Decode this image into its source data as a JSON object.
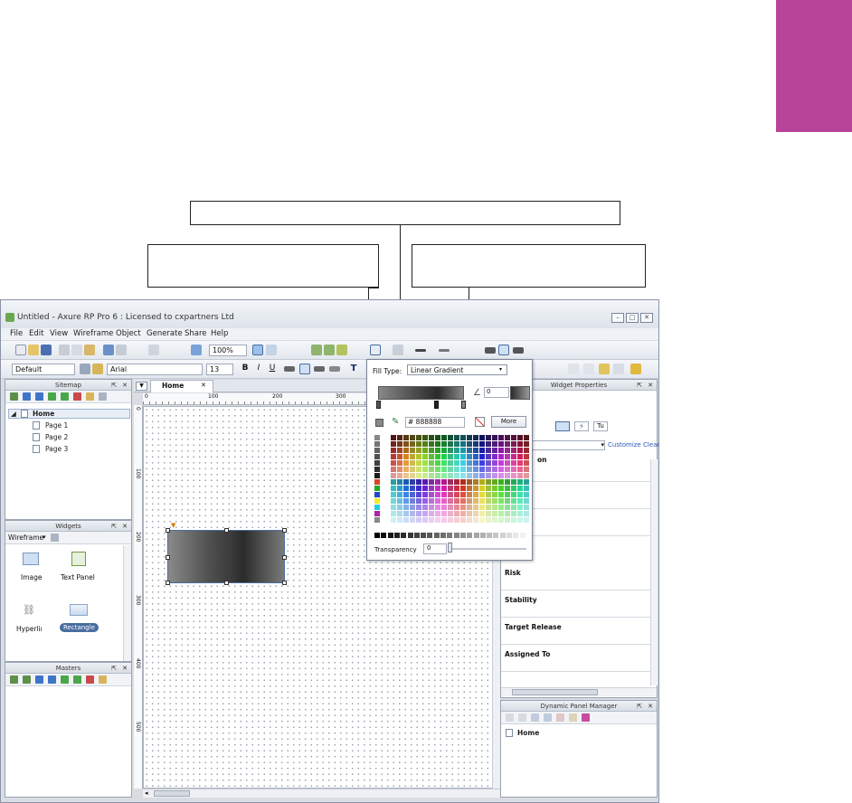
{
  "window": {
    "title": "Untitled - Axure RP Pro 6 : Licensed to cxpartners Ltd"
  },
  "menu": [
    "File",
    "Edit",
    "View",
    "Wireframe",
    "Object",
    "Generate",
    "Share",
    "Help"
  ],
  "toolbar": {
    "zoom": "100%",
    "style": "Default",
    "font": "Arial",
    "size": "13"
  },
  "sitemap": {
    "title": "Sitemap",
    "root": "Home",
    "pages": [
      "Page 1",
      "Page 2",
      "Page 3"
    ]
  },
  "widgets": {
    "title": "Widgets",
    "library": "Wireframe",
    "items": [
      "Image",
      "Text Panel",
      "Hyperlink",
      "Rectangle"
    ]
  },
  "masters": {
    "title": "Masters"
  },
  "canvas": {
    "tab": "Home",
    "ruler_top": [
      "0",
      "100",
      "200",
      "300"
    ],
    "ruler_left": [
      "0",
      "100",
      "200",
      "300",
      "400",
      "500"
    ]
  },
  "fill_popup": {
    "label": "Fill Type:",
    "type": "Linear Gradient",
    "angle": "0",
    "hex": "# 888888",
    "more": "More",
    "transparency_label": "Transparency",
    "transparency": "0"
  },
  "widget_properties": {
    "title": "Widget Properties",
    "customize": "Customize",
    "clear": "Clear",
    "partial": "on",
    "fields": [
      "Risk",
      "Stability",
      "Target Release",
      "Assigned To"
    ]
  },
  "dynamic_panel_manager": {
    "title": "Dynamic Panel Manager",
    "item": "Home"
  },
  "colors": {
    "accent_tab": "#b8449a",
    "selection": "#4a6da0"
  }
}
